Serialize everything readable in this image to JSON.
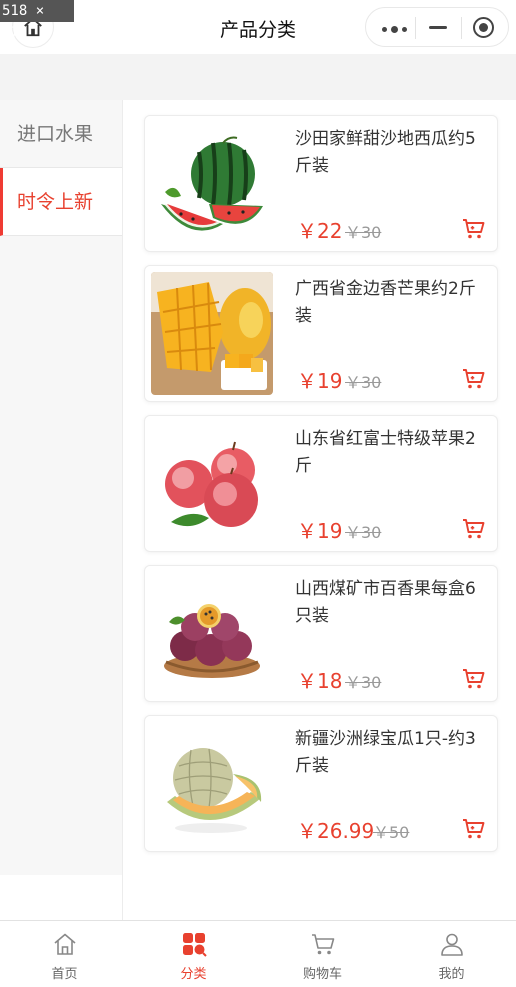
{
  "screen_badge": "518 × 975",
  "nav": {
    "title": "产品分类"
  },
  "sidebar": {
    "items": [
      {
        "label": "进口水果",
        "active": false
      },
      {
        "label": "时令上新",
        "active": true
      }
    ]
  },
  "products": [
    {
      "name": "沙田家鲜甜沙地西瓜约5斤装",
      "price": "￥22",
      "old_price": "￥30",
      "image": "watermelon"
    },
    {
      "name": "广西省金边香芒果约2斤装",
      "price": "￥19",
      "old_price": "￥30",
      "image": "mango"
    },
    {
      "name": "山东省红富士特级苹果2斤",
      "price": "￥19",
      "old_price": "￥30",
      "image": "apple"
    },
    {
      "name": "山西煤矿市百香果每盒6只装",
      "price": "￥18",
      "old_price": "￥30",
      "image": "passion-fruit"
    },
    {
      "name": "新疆沙洲绿宝瓜1只-约3斤装",
      "price": "￥26.99",
      "old_price": "￥50",
      "image": "melon"
    }
  ],
  "tabbar": {
    "items": [
      {
        "label": "首页",
        "icon": "home-icon",
        "active": false
      },
      {
        "label": "分类",
        "icon": "category-grid-icon",
        "active": true
      },
      {
        "label": "购物车",
        "icon": "cart-icon",
        "active": false
      },
      {
        "label": "我的",
        "icon": "user-icon",
        "active": false
      }
    ]
  },
  "colors": {
    "accent": "#e8412f",
    "page_bg": "#f3f3f3",
    "sidebar_bg": "#f7f7f7"
  }
}
